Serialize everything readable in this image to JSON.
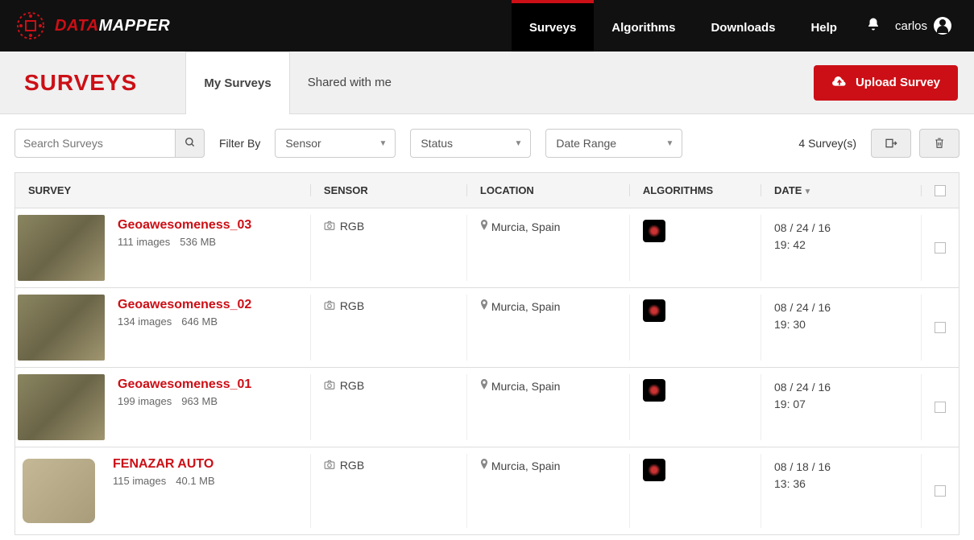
{
  "logo": {
    "line1": "DATA",
    "line2": "MAPPER"
  },
  "nav": {
    "items": [
      "Surveys",
      "Algorithms",
      "Downloads",
      "Help"
    ],
    "user": "carlos"
  },
  "page_title": "SURVEYS",
  "tabs": [
    "My Surveys",
    "Shared with me"
  ],
  "upload_label": "Upload Survey",
  "search_placeholder": "Search Surveys",
  "filter_label": "Filter By",
  "filters": {
    "sensor": "Sensor",
    "status": "Status",
    "date_range": "Date Range"
  },
  "survey_count": "4 Survey(s)",
  "columns": {
    "survey": "SURVEY",
    "sensor": "SENSOR",
    "location": "LOCATION",
    "algorithms": "ALGORITHMS",
    "date": "DATE"
  },
  "rows": [
    {
      "name": "Geoawesomeness_03",
      "images": "111 images",
      "size": "536 MB",
      "sensor": "RGB",
      "location": "Murcia, Spain",
      "date": "08 / 24 / 16",
      "time": "19: 42"
    },
    {
      "name": "Geoawesomeness_02",
      "images": "134 images",
      "size": "646 MB",
      "sensor": "RGB",
      "location": "Murcia, Spain",
      "date": "08 / 24 / 16",
      "time": "19: 30"
    },
    {
      "name": "Geoawesomeness_01",
      "images": "199 images",
      "size": "963 MB",
      "sensor": "RGB",
      "location": "Murcia, Spain",
      "date": "08 / 24 / 16",
      "time": "19: 07"
    },
    {
      "name": "FENAZAR AUTO",
      "images": "115 images",
      "size": "40.1 MB",
      "sensor": "RGB",
      "location": "Murcia, Spain",
      "date": "08 / 18 / 16",
      "time": "13: 36"
    }
  ]
}
